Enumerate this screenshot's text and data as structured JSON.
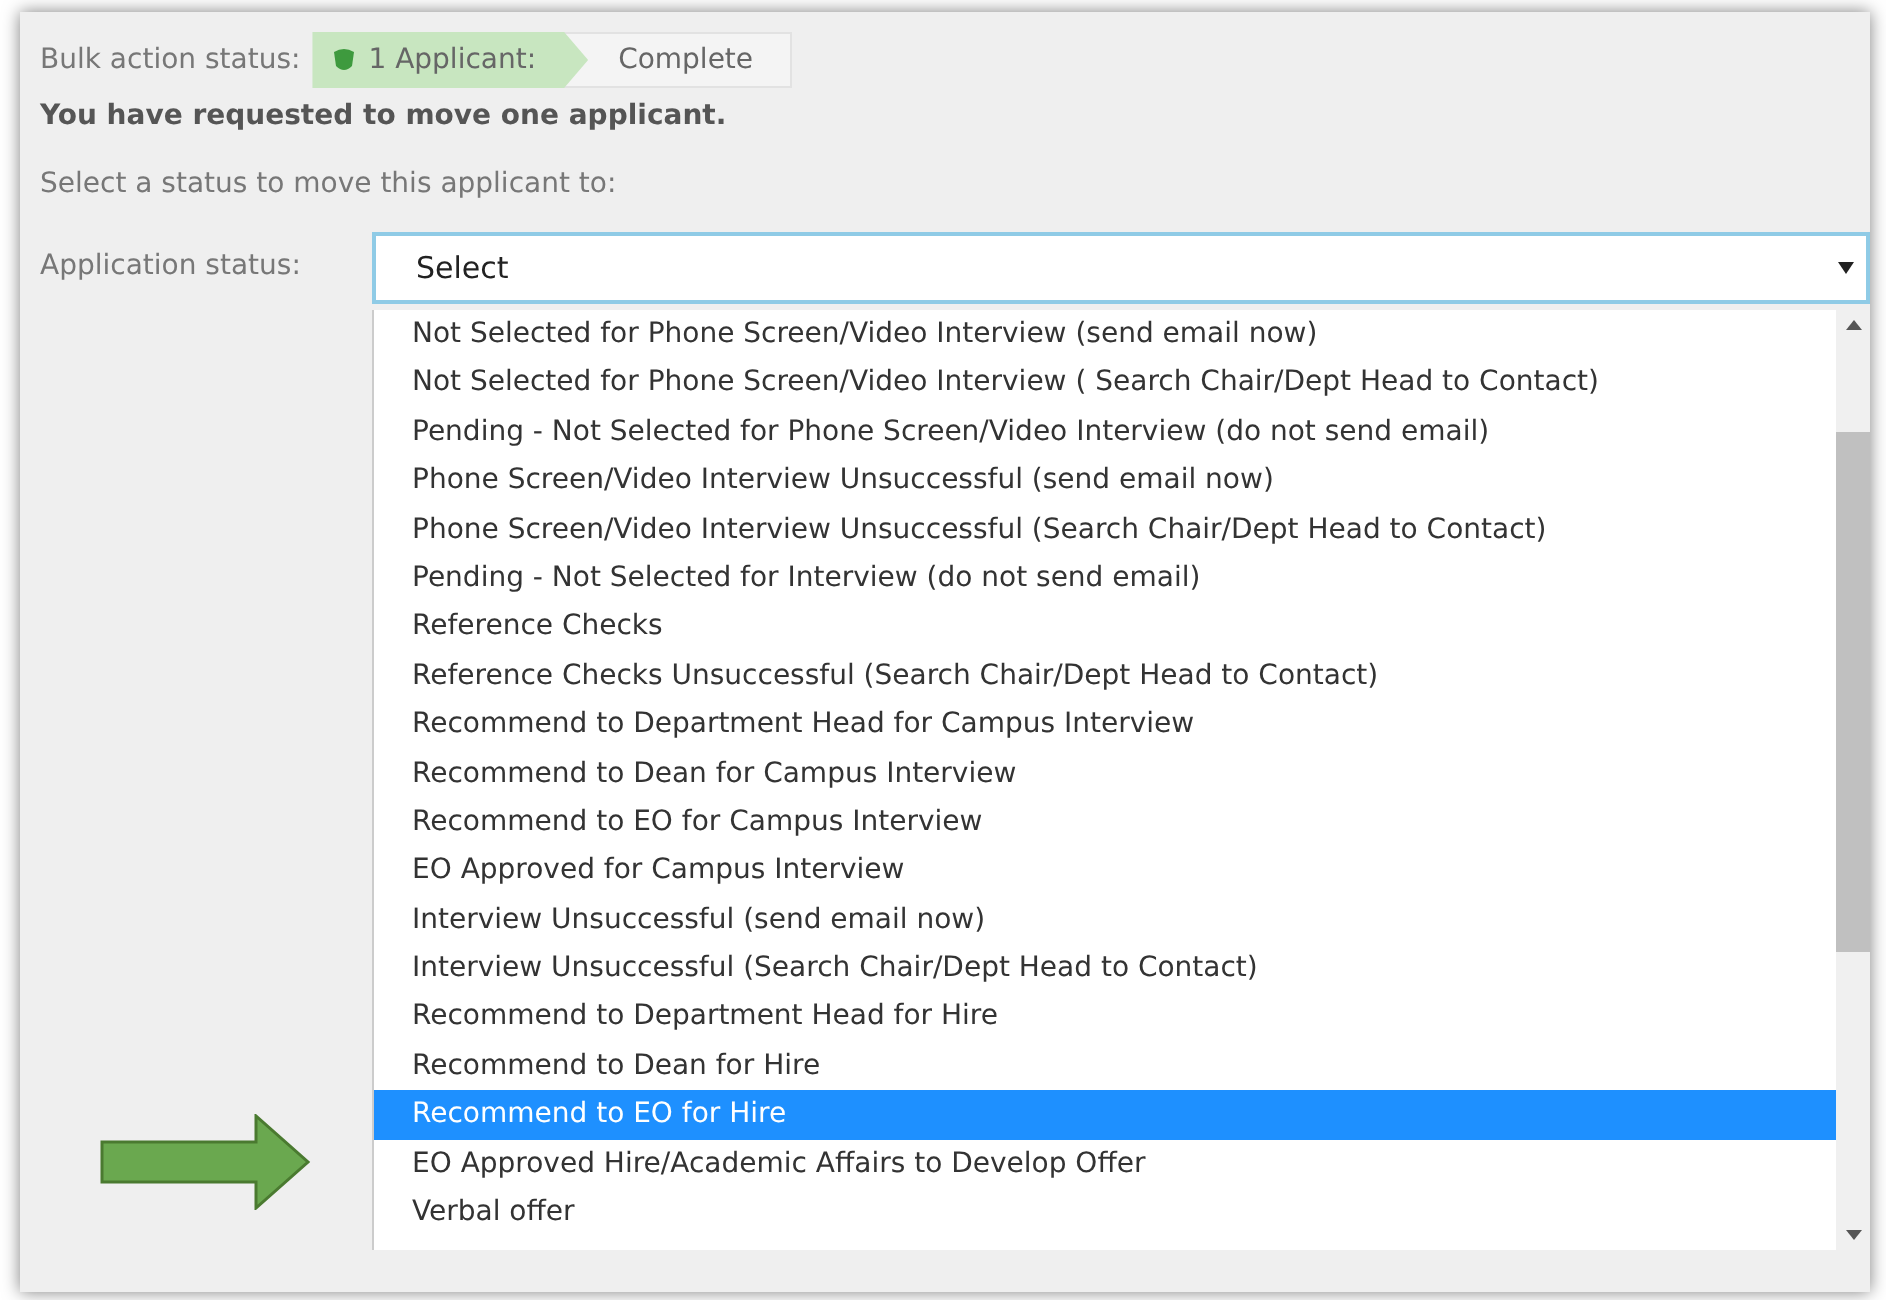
{
  "bulk_status": {
    "label": "Bulk action status:",
    "count": "1 Applicant:",
    "state": "Complete"
  },
  "message": "You have requested to move one applicant.",
  "instruction": "Select a status to move this applicant to:",
  "status_field": {
    "label": "Application status:",
    "value": "Select",
    "expanded": true
  },
  "options": [
    {
      "label": "Not Selected for Phone Screen/Video Interview (send email now)",
      "selected": false
    },
    {
      "label": "Not Selected for Phone Screen/Video Interview ( Search Chair/Dept Head to Contact)",
      "selected": false
    },
    {
      "label": "Pending - Not Selected for Phone Screen/Video Interview (do not send email)",
      "selected": false
    },
    {
      "label": "Phone Screen/Video Interview Unsuccessful (send email now)",
      "selected": false
    },
    {
      "label": "Phone Screen/Video Interview Unsuccessful (Search Chair/Dept Head to Contact)",
      "selected": false
    },
    {
      "label": "Pending - Not Selected for Interview (do not send email)",
      "selected": false
    },
    {
      "label": "Reference Checks",
      "selected": false
    },
    {
      "label": "Reference Checks Unsuccessful (Search Chair/Dept Head to Contact)",
      "selected": false
    },
    {
      "label": "Recommend to Department Head for Campus Interview",
      "selected": false
    },
    {
      "label": "Recommend to Dean for Campus Interview",
      "selected": false
    },
    {
      "label": "Recommend to EO for Campus Interview",
      "selected": false
    },
    {
      "label": "EO Approved for Campus Interview",
      "selected": false
    },
    {
      "label": "Interview Unsuccessful (send email now)",
      "selected": false
    },
    {
      "label": "Interview Unsuccessful (Search Chair/Dept Head to Contact)",
      "selected": false
    },
    {
      "label": "Recommend to Department Head for Hire",
      "selected": false
    },
    {
      "label": "Recommend to Dean for Hire",
      "selected": false
    },
    {
      "label": "Recommend to EO for Hire",
      "selected": true
    },
    {
      "label": "EO Approved Hire/Academic Affairs to Develop Offer",
      "selected": false
    },
    {
      "label": "Verbal offer",
      "selected": false
    }
  ]
}
